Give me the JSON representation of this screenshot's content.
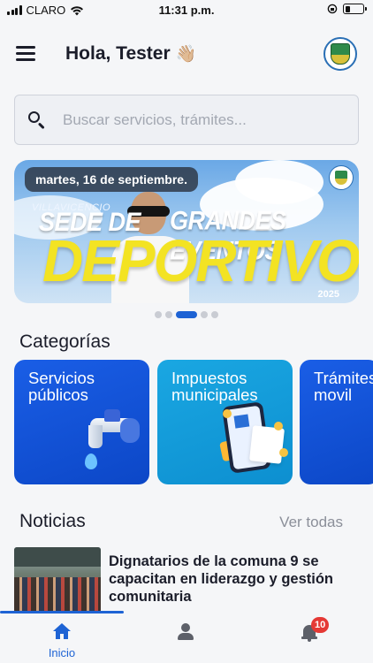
{
  "status_bar": {
    "carrier": "CLARO",
    "time": "11:31 p.m.",
    "battery_level": 0.3
  },
  "header": {
    "greeting": "Hola, Tester",
    "wave_emoji": "👋🏼"
  },
  "search": {
    "placeholder": "Buscar servicios, trámites..."
  },
  "banner": {
    "date": "martes, 16 de septiembre.",
    "city": "VILLAVICENCIO",
    "headline_part1": "SEDE DE",
    "headline_part2": "GRANDES EVENTOS",
    "headline_big": "DEPORTIVOS",
    "year": "2025",
    "slide_count": 5,
    "active_slide": 3
  },
  "categories": {
    "title": "Categorías",
    "items": [
      {
        "label": "Servicios públicos"
      },
      {
        "label": "Impuestos municipales"
      },
      {
        "label": "Trámites movil"
      }
    ]
  },
  "news": {
    "title": "Noticias",
    "see_all": "Ver todas",
    "items": [
      {
        "headline": "Dignatarios de la comuna 9 se capacitan en liderazgo y gestión comunitaria"
      }
    ]
  },
  "bottom_nav": {
    "home_label": "Inicio",
    "notification_count": "10"
  },
  "colors": {
    "accent": "#1e63d4",
    "badge": "#e53935",
    "banner_yellow": "#f3e323"
  }
}
